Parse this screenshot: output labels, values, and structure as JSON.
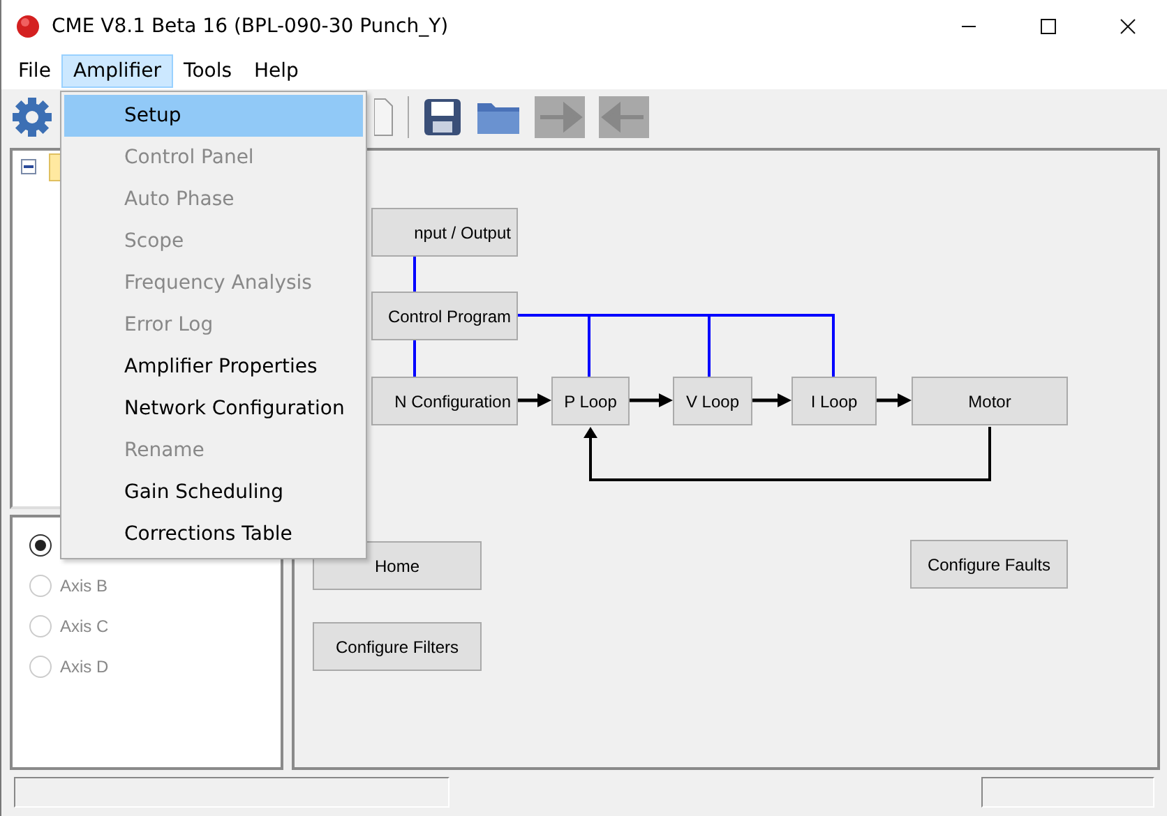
{
  "window": {
    "title": "CME V8.1 Beta 16 (BPL-090-30 Punch_Y)"
  },
  "menubar": [
    {
      "label": "File",
      "selected": false
    },
    {
      "label": "Amplifier",
      "selected": true
    },
    {
      "label": "Tools",
      "selected": false
    },
    {
      "label": "Help",
      "selected": false
    }
  ],
  "dropdown": [
    {
      "label": "Setup",
      "selected": true,
      "disabled": false
    },
    {
      "label": "Control Panel",
      "selected": false,
      "disabled": true
    },
    {
      "label": "Auto Phase",
      "selected": false,
      "disabled": true
    },
    {
      "label": "Scope",
      "selected": false,
      "disabled": true
    },
    {
      "label": "Frequency Analysis",
      "selected": false,
      "disabled": true
    },
    {
      "label": "Error Log",
      "selected": false,
      "disabled": true
    },
    {
      "label": "Amplifier Properties",
      "selected": false,
      "disabled": false
    },
    {
      "label": "Network Configuration",
      "selected": false,
      "disabled": false
    },
    {
      "label": "Rename",
      "selected": false,
      "disabled": true
    },
    {
      "label": "Gain Scheduling",
      "selected": false,
      "disabled": false
    },
    {
      "label": "Corrections Table",
      "selected": false,
      "disabled": false
    }
  ],
  "toolbar": [
    {
      "kind": "settings",
      "disabled": false
    },
    {
      "kind": "document",
      "disabled": false
    },
    {
      "kind": "save",
      "disabled": false
    },
    {
      "kind": "folder",
      "disabled": false
    },
    {
      "kind": "forward",
      "disabled": true
    },
    {
      "kind": "back",
      "disabled": true
    }
  ],
  "axes": [
    {
      "selected": true,
      "disabled": false
    },
    {
      "label": "Axis B",
      "selected": false,
      "disabled": true
    },
    {
      "label": "Axis C",
      "selected": false,
      "disabled": true
    },
    {
      "label": "Axis D",
      "selected": false,
      "disabled": true
    }
  ],
  "diagram": {
    "nodes": [
      {
        "label": "nput / Output"
      },
      {
        "label": "Control Program"
      },
      {
        "label": "N Configuration"
      },
      {
        "label": "P Loop"
      },
      {
        "label": "V Loop"
      },
      {
        "label": "I Loop"
      },
      {
        "label": "Motor"
      }
    ],
    "buttons": [
      {
        "label": "Home"
      },
      {
        "label": "Configure Filters"
      },
      {
        "label": "Configure Faults"
      }
    ]
  }
}
